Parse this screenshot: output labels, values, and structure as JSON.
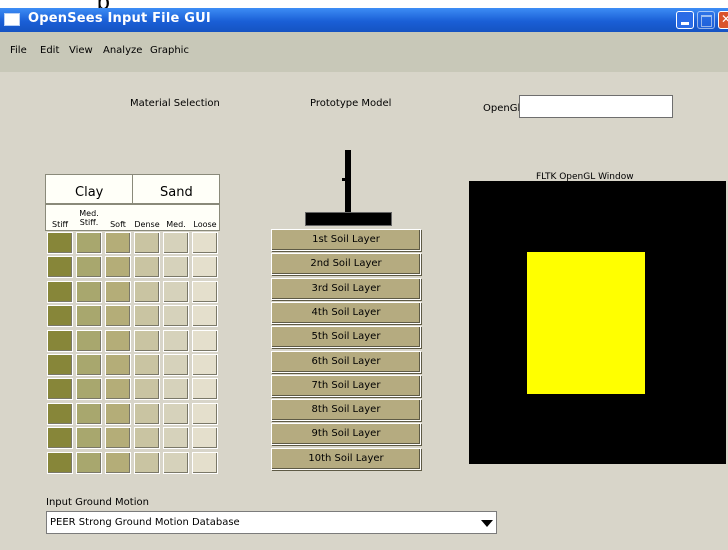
{
  "window": {
    "title": "OpenSees Input File GUI"
  },
  "menu": [
    "File",
    "Edit",
    "View",
    "Analyze",
    "Graphic"
  ],
  "labels": {
    "material_selection": "Material Selection",
    "prototype_model": "Prototype Model",
    "opengl": "OpenGl",
    "fltk_window": "FLTK OpenGL Window",
    "input_ground_motion": "Input Ground Motion"
  },
  "opengl_input": {
    "value": ""
  },
  "material_table": {
    "groups": [
      "Clay",
      "Sand"
    ],
    "columns": [
      "Stiff",
      "Med.\nStiff.",
      "Soft",
      "Dense",
      "Med.",
      "Loose"
    ],
    "column_colors": [
      "#878639",
      "#a8a76e",
      "#b4ad78",
      "#c9c4a2",
      "#d6d2bb",
      "#e4dfcc"
    ],
    "row_count": 10
  },
  "soil_layers": [
    "1st Soil Layer",
    "2nd Soil Layer",
    "3rd Soil Layer",
    "4th Soil Layer",
    "5th Soil Layer",
    "6th  Soil Layer",
    "7th Soil Layer",
    "8th Soil Layer",
    "9th Soil Layer",
    "10th Soil  Layer"
  ],
  "ground_motion": {
    "selected": "PEER Strong Ground Motion Database"
  }
}
